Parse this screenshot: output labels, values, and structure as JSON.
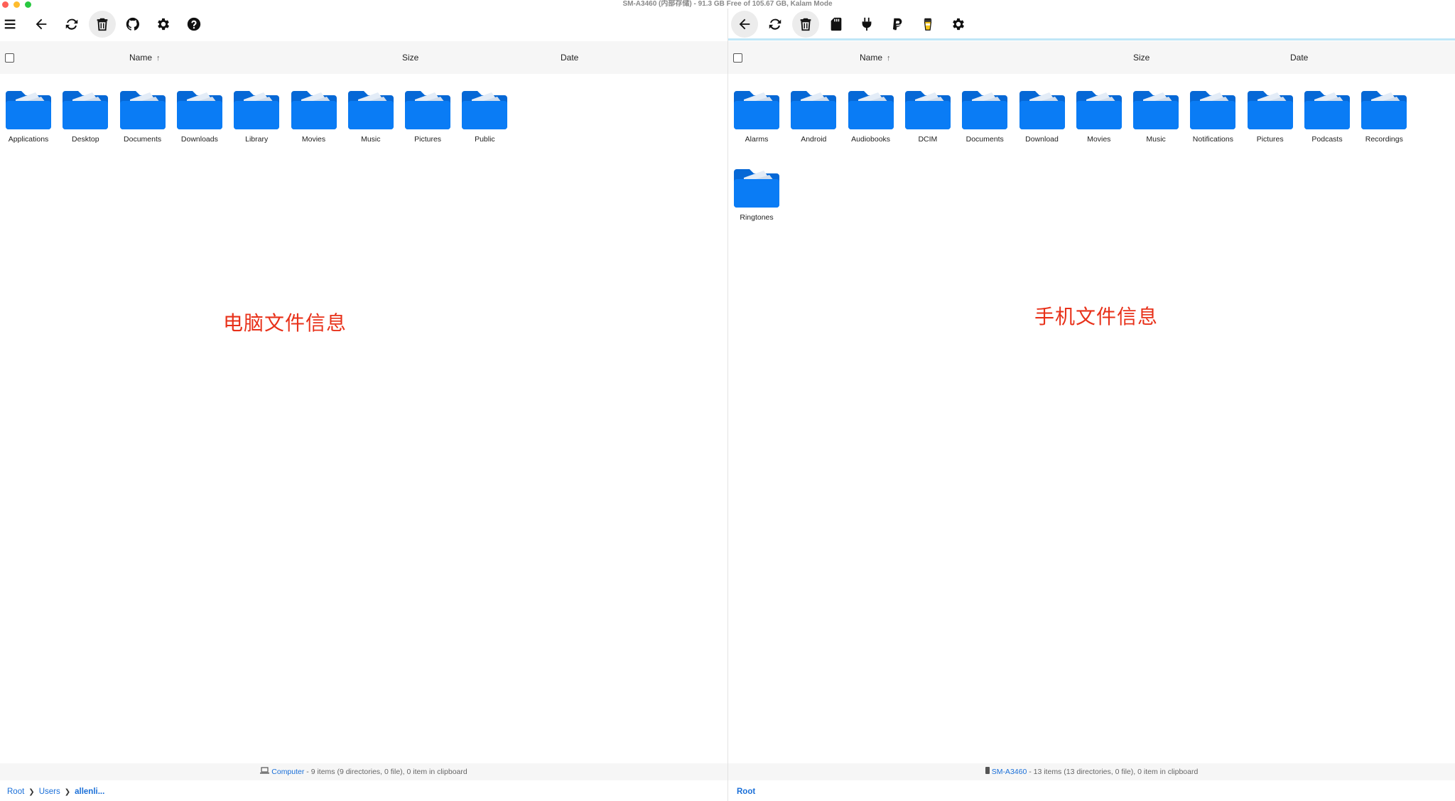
{
  "window": {
    "title": "SM-A3460 (内部存储) - 91.3 GB Free of 105.67 GB, Kalam Mode"
  },
  "left_pane": {
    "columns": {
      "name": "Name",
      "size": "Size",
      "date": "Date"
    },
    "sort_arrow": "↑",
    "folders": [
      "Applications",
      "Desktop",
      "Documents",
      "Downloads",
      "Library",
      "Movies",
      "Music",
      "Pictures",
      "Public"
    ],
    "annotation": "电脑文件信息",
    "status": {
      "device": "Computer",
      "summary": " - 9 items (9 directories, 0 file), 0 item in clipboard"
    },
    "breadcrumb": [
      "Root",
      "Users",
      "allenli..."
    ]
  },
  "right_pane": {
    "columns": {
      "name": "Name",
      "size": "Size",
      "date": "Date"
    },
    "sort_arrow": "↑",
    "folders": [
      "Alarms",
      "Android",
      "Audiobooks",
      "DCIM",
      "Documents",
      "Download",
      "Movies",
      "Music",
      "Notifications",
      "Pictures",
      "Podcasts",
      "Recordings",
      "Ringtones"
    ],
    "annotation": "手机文件信息",
    "status": {
      "device": "SM-A3460",
      "summary": " - 13 items (13 directories, 0 file), 0 item in clipboard"
    },
    "breadcrumb": [
      "Root"
    ]
  },
  "icons": {
    "left_toolbar": [
      "menu-icon",
      "back-arrow-icon",
      "refresh-icon",
      "trash-icon",
      "github-icon",
      "gear-icon",
      "help-icon"
    ],
    "right_toolbar": [
      "back-arrow-icon",
      "refresh-icon",
      "trash-icon",
      "sd-card-icon",
      "plug-icon",
      "paypal-icon",
      "coffee-cup-icon",
      "gear-icon"
    ]
  },
  "colors": {
    "folder": "#0a7cf5",
    "folder_dark": "#0668d6",
    "annotation": "#e8311a",
    "link": "#1a6fd8"
  }
}
